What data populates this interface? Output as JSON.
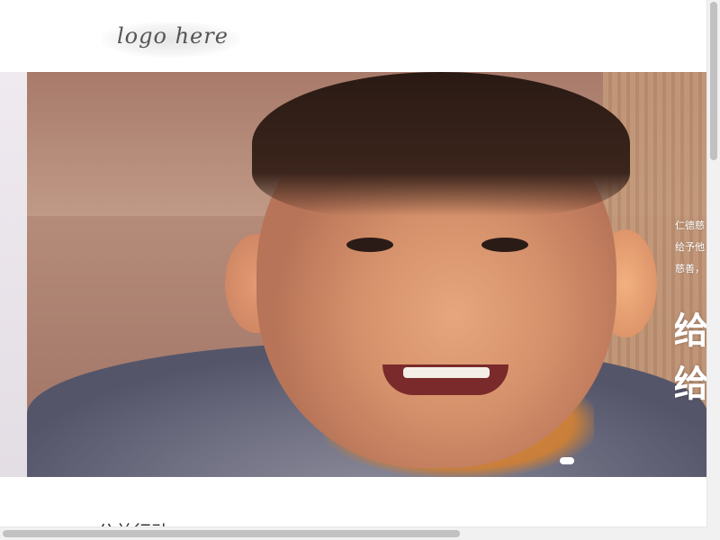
{
  "header": {
    "logo_text": "logo here"
  },
  "hero": {
    "text_lines": [
      "仁德慈",
      "给予他",
      "慈善，"
    ],
    "big_lines": [
      "给",
      "给"
    ],
    "carousel_active_index": 0,
    "colors": {
      "text": "#ffffff",
      "indicator": "#ffffff"
    }
  },
  "section": {
    "title": "公益行动"
  }
}
